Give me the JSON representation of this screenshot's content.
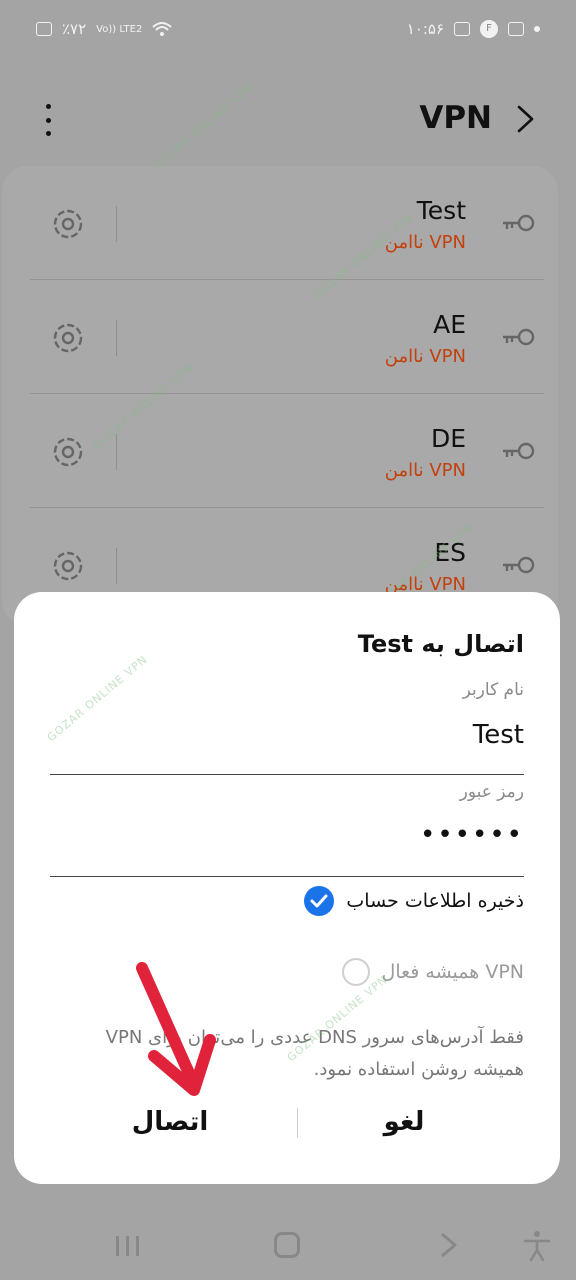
{
  "status_bar": {
    "battery": "٪۷۲",
    "network": "Vo)) LTE2",
    "time": "۱۰:۵۶",
    "notification_badge": "F"
  },
  "header": {
    "title": "VPN",
    "icons": [
      "more-vert-icon",
      "chevron-right-icon"
    ]
  },
  "vpn_list": [
    {
      "name": "Test",
      "status": "VPN ناامن"
    },
    {
      "name": "AE",
      "status": "VPN ناامن"
    },
    {
      "name": "DE",
      "status": "VPN ناامن"
    },
    {
      "name": "ES",
      "status": "VPN ناامن"
    }
  ],
  "dialog": {
    "title": "اتصال به  Test",
    "username_label": "نام کاربر",
    "username_value": "Test",
    "password_label": "رمز عبور",
    "password_value": "••••••",
    "save_account_label": "ذخیره اطلاعات حساب",
    "save_account_checked": true,
    "always_on_label": "VPN همیشه فعال",
    "always_on_checked": false,
    "note": "فقط آدرس‌های سرور DNS عددی را می‌توان برای VPN همیشه روشن استفاده نمود.",
    "connect_label": "اتصال",
    "cancel_label": "لغو"
  },
  "watermark_text": "GOZAR ONLINE VPN",
  "colors": {
    "accent": "#1a73e8",
    "warning": "#c2410c",
    "arrow": "#e0223a",
    "watermark": "#7fbf7f"
  },
  "nav_bar": {
    "icons": [
      "recent-apps-icon",
      "home-icon",
      "back-icon",
      "accessibility-icon"
    ]
  }
}
